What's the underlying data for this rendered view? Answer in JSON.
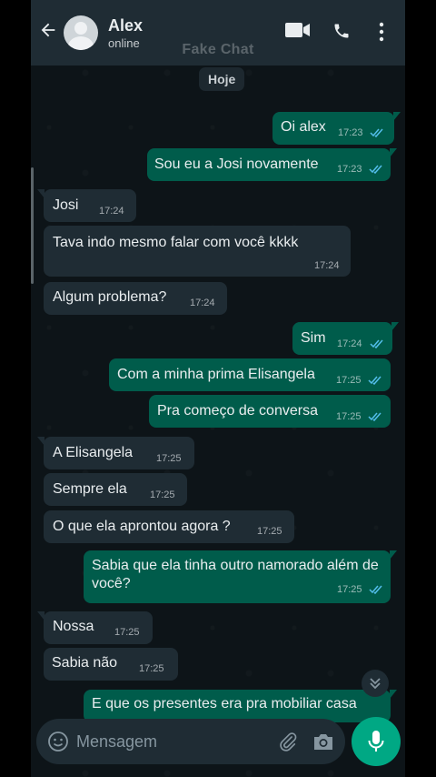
{
  "header": {
    "back_icon": "arrow-left-icon",
    "contact_name": "Alex",
    "status": "online",
    "watermark": "Fake Chat",
    "icons": [
      "video-call-icon",
      "phone-call-icon",
      "more-vert-icon"
    ]
  },
  "date_chip": "Hoje",
  "messages": [
    {
      "dir": "out",
      "text": "Oi alex",
      "time": "17:23"
    },
    {
      "dir": "out",
      "text": "Sou eu a Josi novamente",
      "time": "17:23"
    },
    {
      "dir": "in",
      "text": "Josi",
      "time": "17:24"
    },
    {
      "dir": "in",
      "text": "Tava  indo mesmo falar com você kkkk",
      "time": "17:24"
    },
    {
      "dir": "in",
      "text": "Algum problema?",
      "time": "17:24"
    },
    {
      "dir": "out",
      "text": "Sim",
      "time": "17:24"
    },
    {
      "dir": "out",
      "text": "Com a minha prima Elisangela",
      "time": "17:25"
    },
    {
      "dir": "out",
      "text": "Pra começo de conversa",
      "time": "17:25"
    },
    {
      "dir": "in",
      "text": "A Elisangela",
      "time": "17:25"
    },
    {
      "dir": "in",
      "text": "Sempre ela",
      "time": "17:25"
    },
    {
      "dir": "in",
      "text": "O que ela aprontou agora ?",
      "time": "17:25"
    },
    {
      "dir": "out",
      "text": "Sabia que ela tinha outro namorado além de você?",
      "time": "17:25"
    },
    {
      "dir": "in",
      "text": "Nossa",
      "time": "17:25"
    },
    {
      "dir": "in",
      "text": "Sabia não",
      "time": "17:25"
    },
    {
      "dir": "out",
      "text": "E que os presentes era pra mobiliar casa",
      "time": ""
    }
  ],
  "composer": {
    "placeholder": "Mensagem",
    "icons": [
      "emoji-icon",
      "paperclip-icon",
      "camera-icon",
      "microphone-icon"
    ]
  },
  "colors": {
    "header_bg": "#1f2c34",
    "chat_bg": "#0b141a",
    "outgoing_bubble": "#005c4b",
    "incoming_bubble": "#1f2c34",
    "read_ticks": "#53bdeb",
    "accent": "#00a884"
  }
}
